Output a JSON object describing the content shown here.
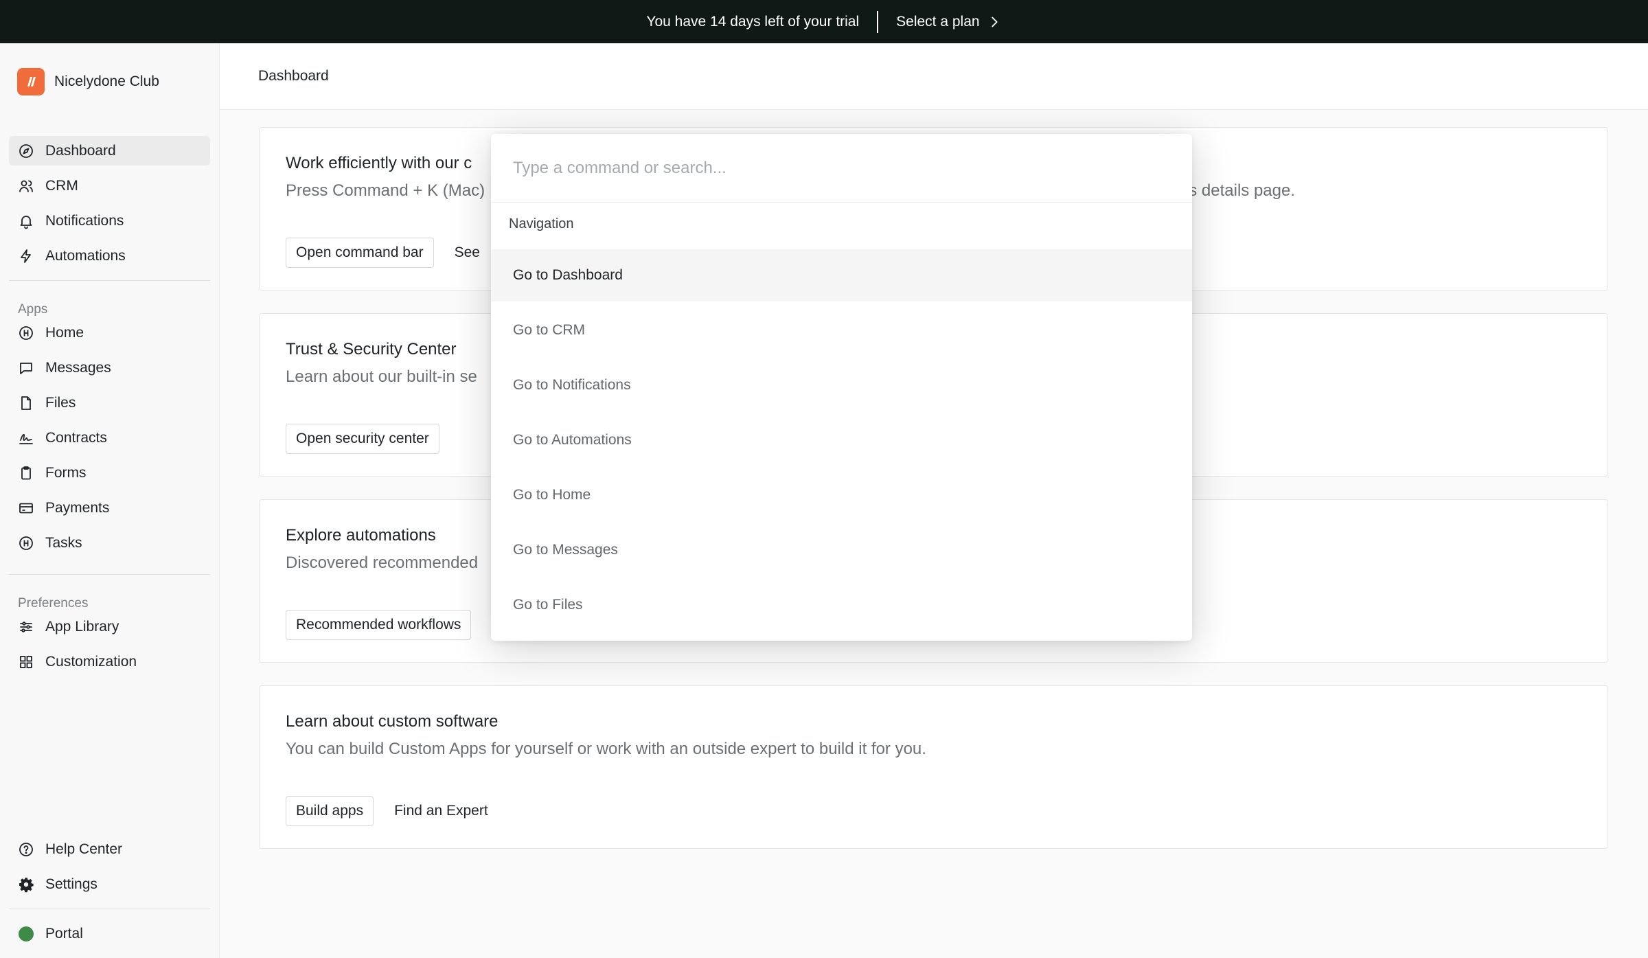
{
  "banner": {
    "trial_text": "You have 14 days left of your trial",
    "select_plan_label": "Select a plan"
  },
  "sidebar": {
    "org_name": "Nicelydone Club",
    "main_items": [
      {
        "label": "Dashboard",
        "icon": "compass-icon",
        "active": true
      },
      {
        "label": "CRM",
        "icon": "users-icon"
      },
      {
        "label": "Notifications",
        "icon": "bell-icon"
      },
      {
        "label": "Automations",
        "icon": "lightning-icon"
      }
    ],
    "apps_label": "Apps",
    "app_items": [
      {
        "label": "Home",
        "icon": "home-app-icon"
      },
      {
        "label": "Messages",
        "icon": "message-icon"
      },
      {
        "label": "Files",
        "icon": "file-icon"
      },
      {
        "label": "Contracts",
        "icon": "signature-icon"
      },
      {
        "label": "Forms",
        "icon": "clipboard-icon"
      },
      {
        "label": "Payments",
        "icon": "credit-card-icon"
      },
      {
        "label": "Tasks",
        "icon": "tasks-app-icon"
      }
    ],
    "preferences_label": "Preferences",
    "preference_items": [
      {
        "label": "App Library",
        "icon": "sliders-icon"
      },
      {
        "label": "Customization",
        "icon": "grid-icon"
      }
    ],
    "footer_items": [
      {
        "label": "Help Center",
        "icon": "help-icon"
      },
      {
        "label": "Settings",
        "icon": "gear-icon"
      }
    ],
    "portal_label": "Portal",
    "portal_color": "#3e8a47"
  },
  "header": {
    "title": "Dashboard"
  },
  "cards": [
    {
      "title": "Work efficiently with our c",
      "desc": "Press Command + K (Mac)",
      "desc_right": "t's details page.",
      "primary": "Open command bar",
      "secondary": "See"
    },
    {
      "title": "Trust & Security Center",
      "desc": "Learn about our built-in se",
      "primary": "Open security center"
    },
    {
      "title": "Explore automations",
      "desc": "Discovered recommended",
      "primary": "Recommended workflows"
    },
    {
      "title": "Learn about custom software",
      "desc": "You can build Custom Apps for yourself or work with an outside expert to build it for you.",
      "primary": "Build apps",
      "secondary": "Find an Expert"
    }
  ],
  "palette": {
    "placeholder": "Type a command or search...",
    "group_label": "Navigation",
    "items": [
      "Go to Dashboard",
      "Go to CRM",
      "Go to Notifications",
      "Go to Automations",
      "Go to Home",
      "Go to Messages",
      "Go to Files"
    ]
  },
  "colors": {
    "banner_bg": "#0f1a17",
    "brand_orange": "#f26b3a",
    "sidebar_bg": "#f8f8f8"
  }
}
